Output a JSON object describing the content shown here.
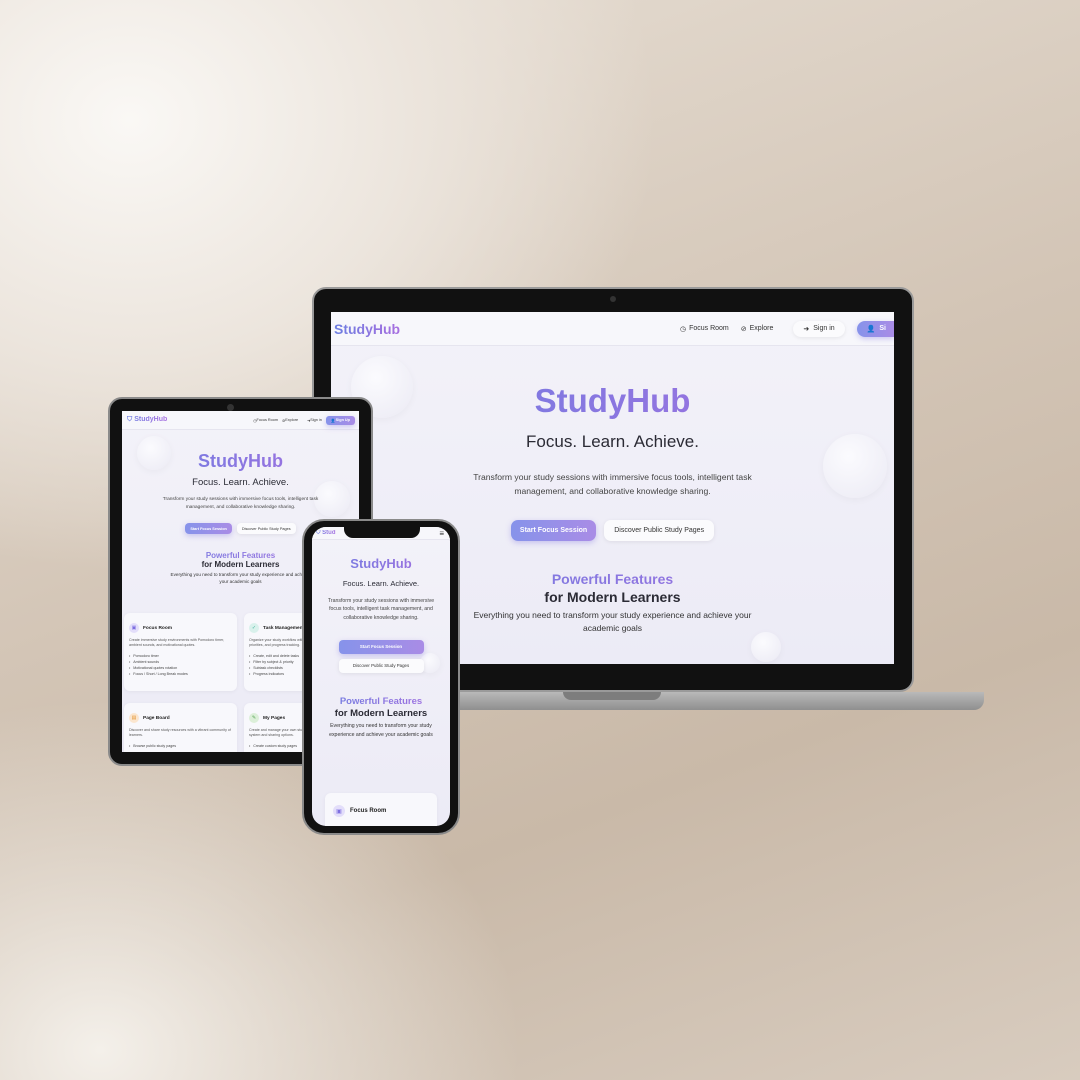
{
  "brand": "StudyHub",
  "nav": {
    "focus_room": "Focus Room",
    "explore": "Explore",
    "sign_in": "Sign in",
    "sign_up": "Sign Up",
    "sign_up_partial": "Si"
  },
  "hero": {
    "title": "StudyHub",
    "tagline": "Focus. Learn. Achieve.",
    "description": "Transform your study sessions with immersive focus tools, intelligent task management, and collaborative knowledge sharing.",
    "primary_cta": "Start Focus Session",
    "secondary_cta": "Discover Public Study Pages"
  },
  "features": {
    "heading_line1": "Powerful Features",
    "heading_line2": "for Modern Learners",
    "subheading": "Everything you need to transform your study experience and achieve your academic goals",
    "cards": [
      {
        "title": "Focus Room",
        "desc": "Create immersive study environments with Pomodoro timer, ambient sounds, and motivational quotes.",
        "items": [
          "Pomodoro timer",
          "Ambient sounds",
          "Motivational quotes rotation",
          "Focus / Short / Long Break modes"
        ]
      },
      {
        "title": "Task Management",
        "desc": "Organize your study workflow with intelligent task organization, priorities, and progress tracking.",
        "items": [
          "Create, edit and delete tasks",
          "Filter by subject & priority",
          "Subtask checklists",
          "Progress indicators"
        ]
      },
      {
        "title": "Page Board",
        "desc": "Discover and share study resources with a vibrant community of learners.",
        "items": [
          "Browse public study pages"
        ]
      },
      {
        "title": "My Pages",
        "desc": "Create and manage your own study pages with a rich editor system and sharing options.",
        "items": [
          "Create custom study pages"
        ]
      }
    ]
  },
  "colors": {
    "brand_start": "#6c7ee1",
    "brand_end": "#a86fe0",
    "background": "#f3f2f9"
  }
}
